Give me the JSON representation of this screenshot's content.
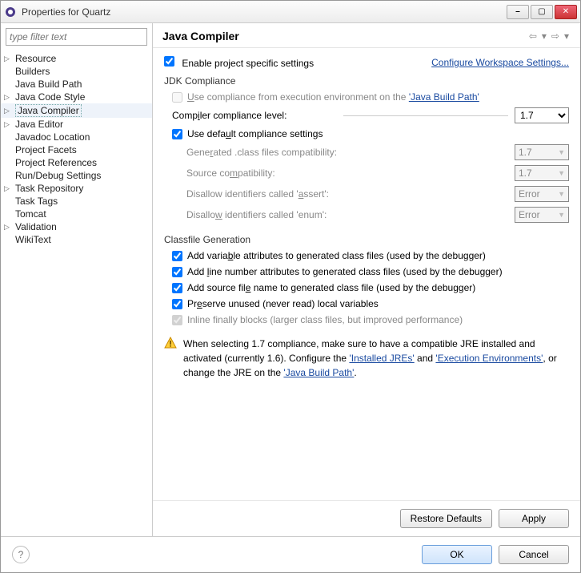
{
  "window": {
    "title": "Properties for Quartz"
  },
  "filter": {
    "placeholder": "type filter text"
  },
  "tree": [
    {
      "label": "Resource",
      "exp": true
    },
    {
      "label": "Builders"
    },
    {
      "label": "Java Build Path"
    },
    {
      "label": "Java Code Style",
      "exp": true
    },
    {
      "label": "Java Compiler",
      "exp": true,
      "selected": true
    },
    {
      "label": "Java Editor",
      "exp": true
    },
    {
      "label": "Javadoc Location"
    },
    {
      "label": "Project Facets"
    },
    {
      "label": "Project References"
    },
    {
      "label": "Run/Debug Settings"
    },
    {
      "label": "Task Repository",
      "exp": true
    },
    {
      "label": "Task Tags"
    },
    {
      "label": "Tomcat"
    },
    {
      "label": "Validation",
      "exp": true
    },
    {
      "label": "WikiText"
    }
  ],
  "page": {
    "title": "Java Compiler",
    "enable_label": "Enable project specific settings",
    "enable_checked": true,
    "configure_link": "Configure Workspace Settings...",
    "jdk": {
      "legend": "JDK Compliance",
      "use_env_label_pre": "Use compliance from execution environment on the ",
      "use_env_link": "'Java Build Path'",
      "use_env_checked": false,
      "level_label": "Compiler compliance level:",
      "level_value": "1.7",
      "use_default_label": "Use default compliance settings",
      "use_default_checked": true,
      "gen_label": "Generated .class files compatibility:",
      "gen_value": "1.7",
      "src_label": "Source compatibility:",
      "src_value": "1.7",
      "assert_label": "Disallow identifiers called 'assert':",
      "assert_value": "Error",
      "enum_label": "Disallow identifiers called 'enum':",
      "enum_value": "Error"
    },
    "classfile": {
      "legend": "Classfile Generation",
      "var_attr": {
        "label": "Add variable attributes to generated class files (used by the debugger)",
        "checked": true
      },
      "line_attr": {
        "label": "Add line number attributes to generated class files (used by the debugger)",
        "checked": true
      },
      "src_file": {
        "label": "Add source file name to generated class file (used by the debugger)",
        "checked": true
      },
      "preserve": {
        "label": "Preserve unused (never read) local variables",
        "checked": true
      },
      "inline": {
        "label": "Inline finally blocks (larger class files, but improved performance)",
        "checked": true,
        "disabled": true
      }
    },
    "warning": {
      "pre": "When selecting 1.7 compliance, make sure to have a compatible JRE installed and activated (currently 1.6). Configure the ",
      "link1": "'Installed JREs'",
      "mid1": " and ",
      "link2": "'Execution Environments'",
      "mid2": ", or change the JRE on the ",
      "link3": "'Java Build Path'",
      "post": "."
    },
    "restore": "Restore Defaults",
    "apply": "Apply"
  },
  "footer": {
    "ok": "OK",
    "cancel": "Cancel"
  }
}
